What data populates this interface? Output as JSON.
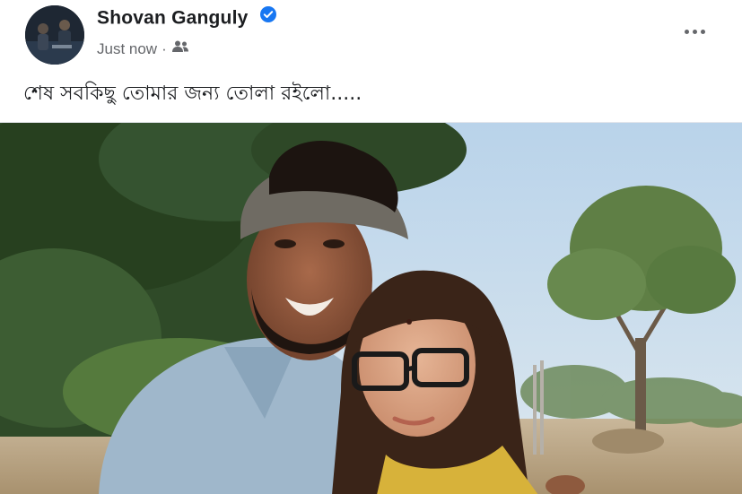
{
  "post": {
    "author": {
      "name": "Shovan Ganguly",
      "verified": true,
      "avatar_icon": "profile-avatar"
    },
    "meta": {
      "time": "Just now",
      "separator": "·",
      "audience_icon": "friends-audience-icon"
    },
    "more_icon": "more-options-icon",
    "caption": "শেষ সবকিছু তোমার জন্য তোলা রইলো.....",
    "photo": {
      "content": "photo-couple-outdoors"
    }
  },
  "colors": {
    "name_text": "#1c1e21",
    "meta_text": "#65676b",
    "verified_badge": "#1877f2",
    "sky": "#c9dcec",
    "foliage": "#2f4a28"
  }
}
